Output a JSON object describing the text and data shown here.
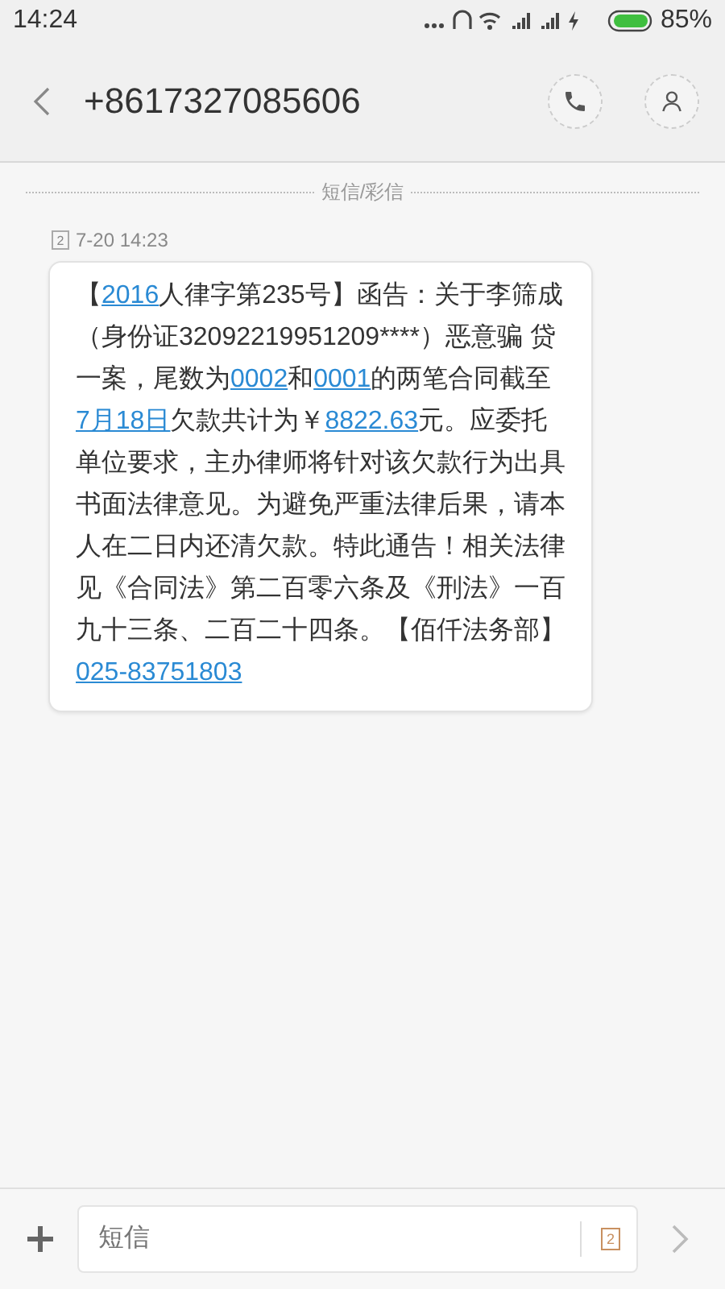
{
  "status_bar": {
    "time": "14:24",
    "battery": "85%"
  },
  "header": {
    "title": "+8617327085606"
  },
  "divider_label": "短信/彩信",
  "message": {
    "sim": "2",
    "time": "7-20 14:23",
    "segments": [
      {
        "text": "【",
        "link": false
      },
      {
        "text": "2016",
        "link": true
      },
      {
        "text": "人律字第235号】函告：关于李筛成（身份证32092219951209****）恶意骗 贷一案，尾数为",
        "link": false
      },
      {
        "text": "0002",
        "link": true
      },
      {
        "text": "和",
        "link": false
      },
      {
        "text": "0001",
        "link": true
      },
      {
        "text": "的两笔合同截至",
        "link": false
      },
      {
        "text": "7月18日",
        "link": true
      },
      {
        "text": "欠款共计为￥",
        "link": false
      },
      {
        "text": "8822.63",
        "link": true
      },
      {
        "text": "元。应委托单位要求，主办律师将针对该欠款行为出具书面法律意见。为避免严重法律后果，请本人在二日内还清欠款。特此通告！相关法律见《合同法》第二百零六条及《刑法》一百九十三条、二百二十四条。【佰仟法务部】",
        "link": false
      },
      {
        "text": "025-83751803",
        "link": true
      }
    ]
  },
  "composer": {
    "placeholder": "短信",
    "sim": "2"
  }
}
